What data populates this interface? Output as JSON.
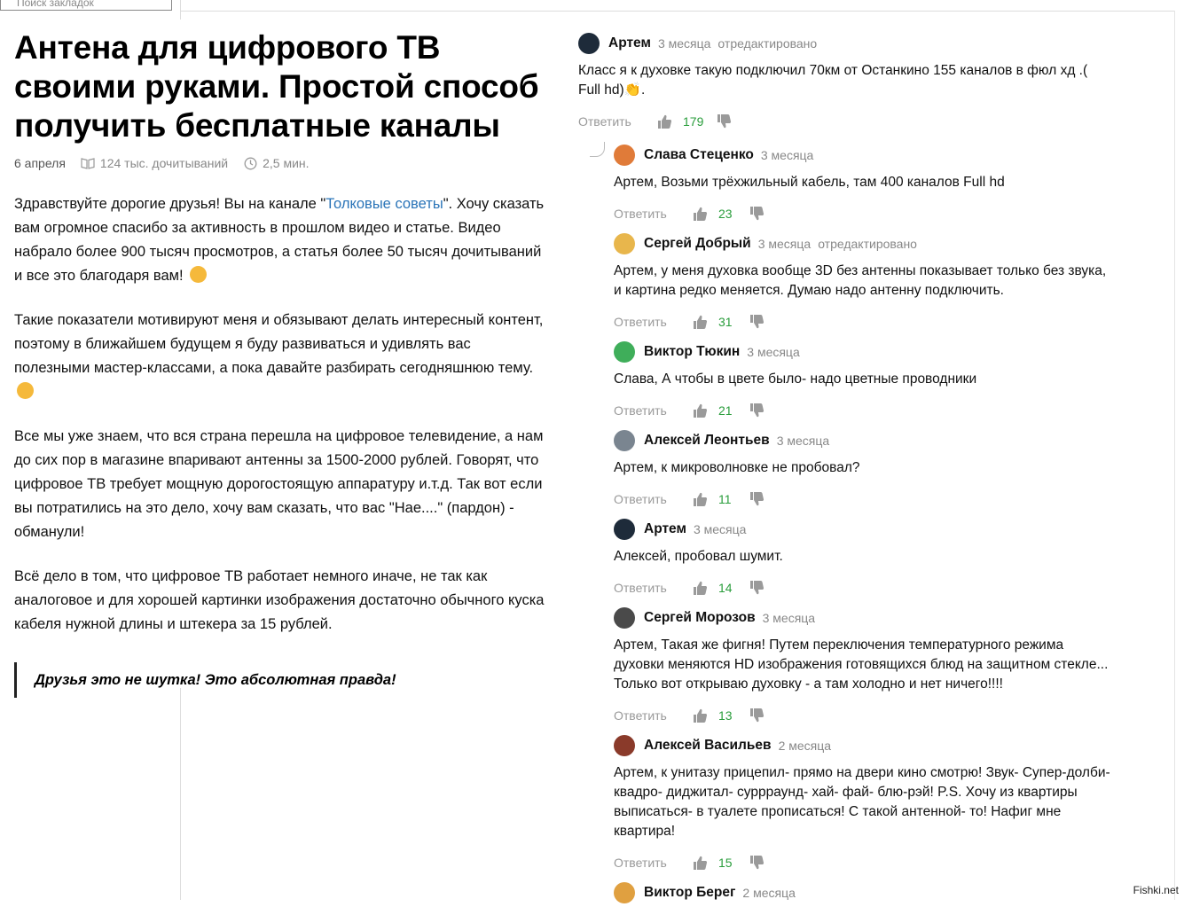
{
  "search": {
    "placeholder": "Поиск закладок"
  },
  "article": {
    "title": "Антена для цифрового ТВ своими руками. Простой способ получить бесплатные каналы",
    "date": "6 апреля",
    "reads": "124 тыс. дочитываний",
    "read_time": "2,5 мин.",
    "p1_a": "Здравствуйте дорогие друзья! Вы на канале \"",
    "p1_link": "Толковые советы",
    "p1_b": "\". Хочу сказать вам огромное спасибо за активность в прошлом видео и статье. Видео набрало более 900 тысяч просмотров, а статья более 50 тысяч дочитываний и все это благодаря вам!",
    "p2": "Такие показатели мотивируют меня и обязывают делать интересный контент, поэтому в ближайшем будущем я буду развиваться и удивлять вас полезными мастер-классами, а пока давайте разбирать сегодняшнюю тему.",
    "p3": "Все мы уже знаем, что вся страна перешла на цифровое телевидение, а нам до сих пор в магазине впаривают антенны за 1500-2000 рублей. Говорят, что цифровое ТВ требует мощную дорогостоящую аппаратуру и.т.д. Так вот если вы потратились на это дело, хочу вам сказать, что вас \"Нае....\" (пардон) - обманули!",
    "p4": "Всё дело в том, что цифровое ТВ работает немного иначе, не так как аналоговое и для хорошей картинки изображения достаточно обычного куска кабеля нужной длины и штекера за 15 рублей.",
    "quote": "Друзья это не шутка! Это абсолютная правда!"
  },
  "reply_label": "Ответить",
  "comments": [
    {
      "name": "Артем",
      "time": "3 месяца",
      "edited": "отредактировано",
      "text": "Класс я к духовке такую подключил 70км от Останкино 155 каналов в фюл хд .( Full hd)👏.",
      "likes": "179",
      "avatar_color": "#1e2b3a"
    },
    {
      "name": "Слава Стеценко",
      "time": "3 месяца",
      "edited": "",
      "text": "Артем, Возьми трёхжильный кабель, там 400 каналов Full hd",
      "likes": "23",
      "avatar_color": "#e07b39"
    },
    {
      "name": "Сергей Добрый",
      "time": "3 месяца",
      "edited": "отредактировано",
      "text": "Артем, у меня духовка вообще 3D без антенны показывает только без звука, и картина редко меняется. Думаю надо антенну подключить.",
      "likes": "31",
      "avatar_color": "#e8b64c"
    },
    {
      "name": "Виктор Тюкин",
      "time": "3 месяца",
      "edited": "",
      "text": "Слава, А чтобы в цвете было- надо цветные проводники",
      "likes": "21",
      "avatar_color": "#3fae5a"
    },
    {
      "name": "Алексей Леонтьев",
      "time": "3 месяца",
      "edited": "",
      "text": "Артем, к микроволновке не пробовал?",
      "likes": "11",
      "avatar_color": "#7a8590"
    },
    {
      "name": "Артем",
      "time": "3 месяца",
      "edited": "",
      "text": "Алексей, пробовал шумит.",
      "likes": "14",
      "avatar_color": "#1e2b3a"
    },
    {
      "name": "Сергей Морозов",
      "time": "3 месяца",
      "edited": "",
      "text": "Артем, Такая же фигня! Путем переключения температурного режима духовки меняются HD изображения готовящихся блюд на защитном стекле... Только вот открываю духовку - а там холодно и нет ничего!!!!",
      "likes": "13",
      "avatar_color": "#4a4a4a"
    },
    {
      "name": "Алексей Васильев",
      "time": "2 месяца",
      "edited": "",
      "text": "Артем, к унитазу прицепил- прямо на двери кино смотрю! Звук- Супер-долби- квадро- диджитал- суррраунд- хай- фай- блю-рэй! P.S. Хочу из квартиры выписаться- в туалете прописаться! С такой антенной- то! Нафиг мне квартира!",
      "likes": "15",
      "avatar_color": "#8a3a2a"
    },
    {
      "name": "Виктор Берег",
      "time": "2 месяца",
      "edited": "",
      "text": "",
      "likes": "",
      "avatar_color": "#e0a040"
    }
  ],
  "watermark": "Fishki.net"
}
